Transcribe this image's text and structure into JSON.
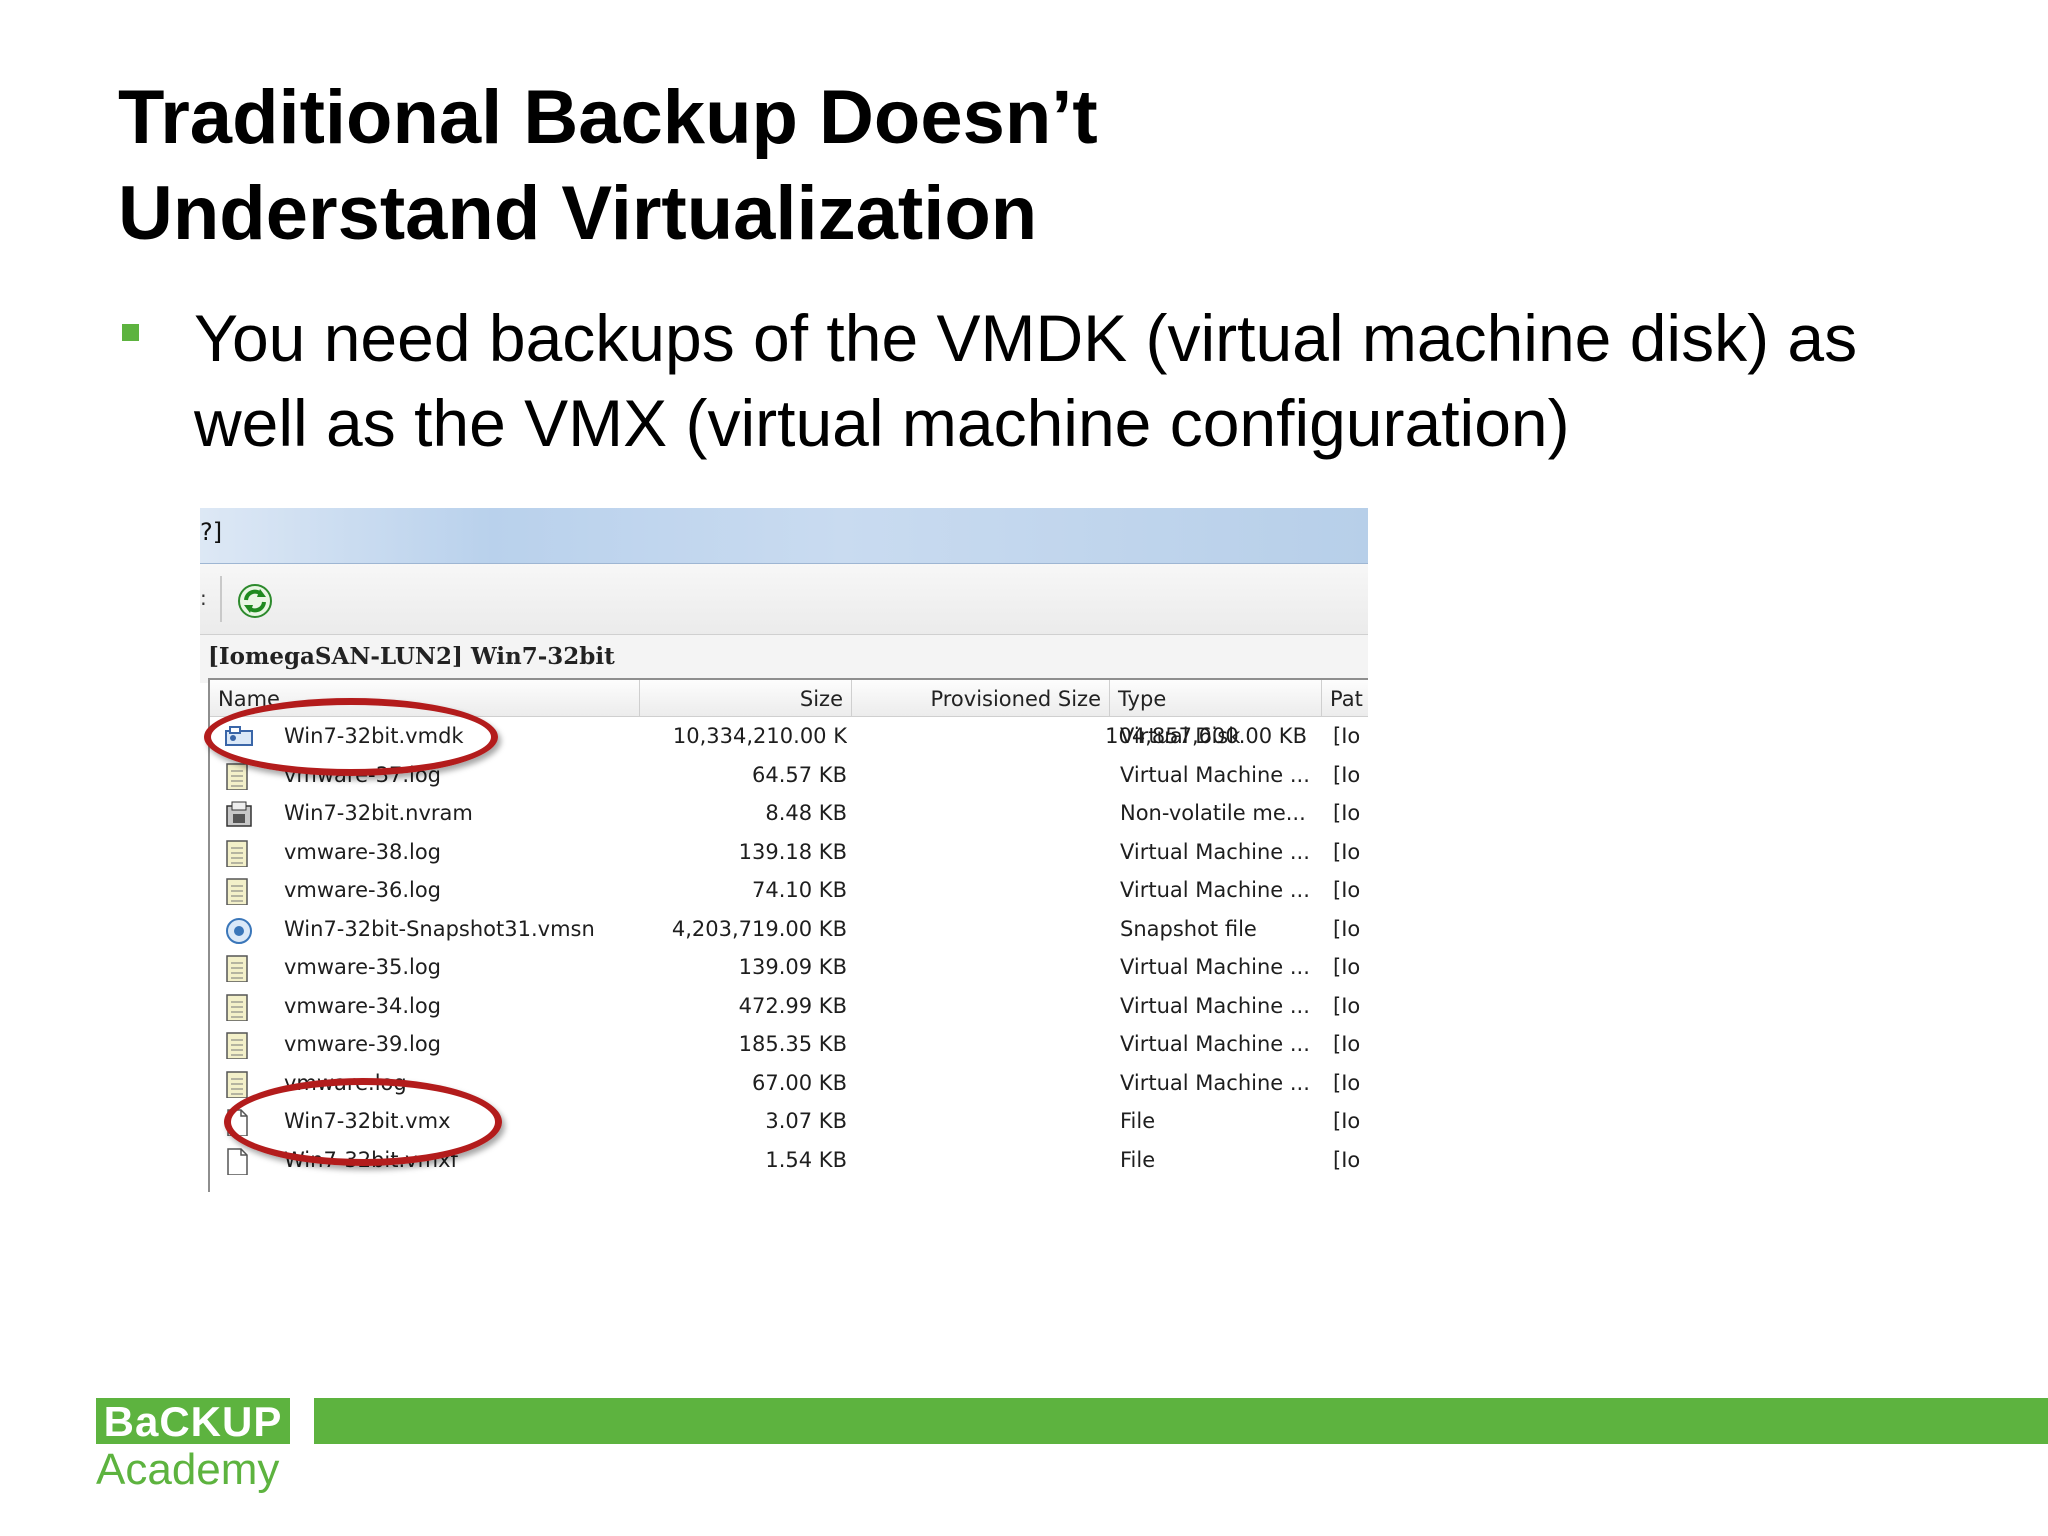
{
  "slide": {
    "title_line1": "Traditional Backup Doesn’t",
    "title_line2": "Understand Virtualization",
    "bullet": "You need backups of the VMDK (virtual machine disk) as well as the VMX (virtual machine configuration)"
  },
  "screenshot": {
    "titlebar_fragment": "?]",
    "toolbar_fragment": ":",
    "refresh_icon": "refresh-icon",
    "path": "[IomegaSAN-LUN2] Win7-32bit",
    "columns": [
      "Name",
      "Size",
      "Provisioned Size",
      "Type",
      "Pat"
    ],
    "files": [
      {
        "name": "Win7-32bit.vmdk",
        "size": "10,334,210.00 K",
        "provisioned": "104,857,600.00 KB",
        "type": "Virtual Disk",
        "path": "[Io",
        "icon": "virtual-disk-icon",
        "highlighted": true
      },
      {
        "name": "vmware-37.log",
        "size": "64.57 KB",
        "provisioned": "",
        "type": "Virtual Machine ...",
        "path": "[Io",
        "icon": "log-file-icon",
        "highlighted": false
      },
      {
        "name": "Win7-32bit.nvram",
        "size": "8.48 KB",
        "provisioned": "",
        "type": "Non-volatile me...",
        "path": "[Io",
        "icon": "nvram-icon",
        "highlighted": false
      },
      {
        "name": "vmware-38.log",
        "size": "139.18 KB",
        "provisioned": "",
        "type": "Virtual Machine ...",
        "path": "[Io",
        "icon": "log-file-icon",
        "highlighted": false
      },
      {
        "name": "vmware-36.log",
        "size": "74.10 KB",
        "provisioned": "",
        "type": "Virtual Machine ...",
        "path": "[Io",
        "icon": "log-file-icon",
        "highlighted": false
      },
      {
        "name": "Win7-32bit-Snapshot31.vmsn",
        "size": "4,203,719.00 KB",
        "provisioned": "",
        "type": "Snapshot file",
        "path": "[Io",
        "icon": "snapshot-icon",
        "highlighted": false
      },
      {
        "name": "vmware-35.log",
        "size": "139.09 KB",
        "provisioned": "",
        "type": "Virtual Machine ...",
        "path": "[Io",
        "icon": "log-file-icon",
        "highlighted": false
      },
      {
        "name": "vmware-34.log",
        "size": "472.99 KB",
        "provisioned": "",
        "type": "Virtual Machine ...",
        "path": "[Io",
        "icon": "log-file-icon",
        "highlighted": false
      },
      {
        "name": "vmware-39.log",
        "size": "185.35 KB",
        "provisioned": "",
        "type": "Virtual Machine ...",
        "path": "[Io",
        "icon": "log-file-icon",
        "highlighted": false
      },
      {
        "name": "vmware.log",
        "size": "67.00 KB",
        "provisioned": "",
        "type": "Virtual Machine ...",
        "path": "[Io",
        "icon": "log-file-icon",
        "highlighted": false
      },
      {
        "name": "Win7-32bit.vmx",
        "size": "3.07 KB",
        "provisioned": "",
        "type": "File",
        "path": "[Io",
        "icon": "generic-file-icon",
        "highlighted": true
      },
      {
        "name": "Win7-32bit.vmxf",
        "size": "1.54 KB",
        "provisioned": "",
        "type": "File",
        "path": "[Io",
        "icon": "generic-file-icon",
        "highlighted": false
      }
    ],
    "highlight_color": "#b31c1c"
  },
  "footer": {
    "logo_top": "BaCKUP",
    "logo_bottom": "Academy",
    "brand_color": "#5db33f"
  }
}
